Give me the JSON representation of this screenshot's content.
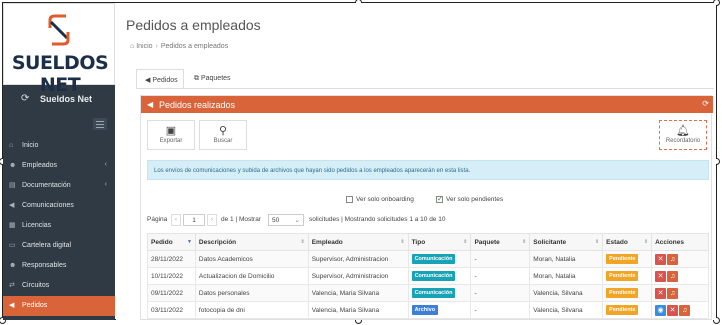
{
  "sidebar": {
    "logo_text": "SUELDOS NET",
    "brand": "Sueldos Net",
    "items": [
      {
        "label": "Inicio",
        "icon": "home-icon",
        "has_submenu": false,
        "active": false
      },
      {
        "label": "Empleados",
        "icon": "users-icon",
        "has_submenu": true,
        "active": false
      },
      {
        "label": "Documentación",
        "icon": "document-icon",
        "has_submenu": true,
        "active": false
      },
      {
        "label": "Comunicaciones",
        "icon": "megaphone-icon",
        "has_submenu": false,
        "active": false
      },
      {
        "label": "Licencias",
        "icon": "calendar-icon",
        "has_submenu": false,
        "active": false
      },
      {
        "label": "Cartelera digital",
        "icon": "board-icon",
        "has_submenu": false,
        "active": false
      },
      {
        "label": "Responsables",
        "icon": "users-icon",
        "has_submenu": false,
        "active": false
      },
      {
        "label": "Circuitos",
        "icon": "flow-icon",
        "has_submenu": false,
        "active": false
      },
      {
        "label": "Pedidos",
        "icon": "megaphone-icon",
        "has_submenu": false,
        "active": true
      }
    ]
  },
  "header": {
    "title": "Pedidos a empleados",
    "breadcrumb": [
      "Inicio",
      "Pedidos a empleados"
    ]
  },
  "tabs": [
    {
      "label": "Pedidos",
      "icon": "megaphone-icon",
      "active": true
    },
    {
      "label": "Paquetes",
      "icon": "copy-icon",
      "active": false
    }
  ],
  "panel": {
    "title": "Pedidos realizados",
    "tools": {
      "export_label": "Exportar",
      "search_label": "Buscar",
      "reminder_label": "Recordatorio"
    },
    "info": "Los envíos de comunicaciones y subida de archivos que hayan sido pedidos a los empleados aparecerán en esta lista.",
    "filters": {
      "onboarding_label": "Ver solo onboarding",
      "onboarding_checked": false,
      "pending_label": "Ver solo pendientes",
      "pending_checked": true
    },
    "pager": {
      "page_label": "Página",
      "page_value": "1",
      "of_label": "de 1 | Mostrar",
      "page_size": "50",
      "summary": "solicitudes | Mostrando solicitudes 1 a 10 de 10"
    },
    "columns": [
      "Pedido",
      "Descripción",
      "Empleado",
      "Tipo",
      "Paquete",
      "Solicitante",
      "Estado",
      "Acciones"
    ],
    "rows": [
      {
        "pedido": "28/11/2022",
        "descripcion": "Datos Academicos",
        "empleado": "Supervisor, Administracion",
        "tipo": "Comunicación",
        "paquete": "-",
        "solicitante": "Moran, Natalia",
        "estado": "Pendiente"
      },
      {
        "pedido": "10/11/2022",
        "descripcion": "Actualizacion de Domicilio",
        "empleado": "Supervisor, Administracion",
        "tipo": "Comunicación",
        "paquete": "-",
        "solicitante": "Moran, Natalia",
        "estado": "Pendiente"
      },
      {
        "pedido": "09/11/2022",
        "descripcion": "Datos personales",
        "empleado": "Valencia, Maria Silvana",
        "tipo": "Comunicación",
        "paquete": "-",
        "solicitante": "Valencia, Silvana",
        "estado": "Pendiente"
      },
      {
        "pedido": "03/11/2022",
        "descripcion": "fotocopia de dni",
        "empleado": "Valencia, Maria Silvana",
        "tipo": "Archivo",
        "paquete": "-",
        "solicitante": "Valencia, Silvana",
        "estado": "Pendiente"
      }
    ]
  },
  "colors": {
    "accent": "#d9643a",
    "sidebar_bg": "#2f3a44",
    "badge_comunicacion": "#17a2b8",
    "badge_archivo": "#3d7fd6",
    "badge_pendiente": "#f0a526"
  }
}
